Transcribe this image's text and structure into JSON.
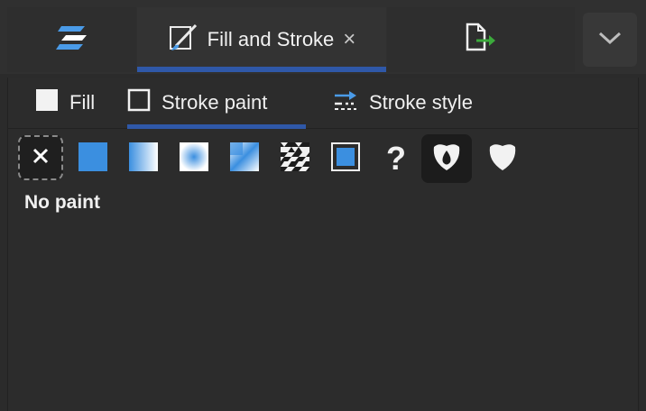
{
  "dock": {
    "active_tab_title": "Fill and Stroke",
    "close_glyph": "×",
    "tabs": [
      {
        "icon": "align-distribute-icon"
      },
      {
        "icon": "fill-and-stroke-icon",
        "title": "Fill and Stroke"
      },
      {
        "icon": "export-icon"
      }
    ],
    "menu_icon": "chevron-down-icon"
  },
  "subtabs": [
    {
      "label": "Fill",
      "icon": "fill-swatch-icon"
    },
    {
      "label": "Stroke paint",
      "icon": "stroke-swatch-icon",
      "active": true
    },
    {
      "label": "Stroke style",
      "icon": "stroke-style-icon"
    }
  ],
  "paint_modes": [
    {
      "name": "no-paint",
      "selected": true
    },
    {
      "name": "flat-color"
    },
    {
      "name": "linear-gradient"
    },
    {
      "name": "radial-gradient"
    },
    {
      "name": "mesh-gradient"
    },
    {
      "name": "pattern"
    },
    {
      "name": "swatch"
    },
    {
      "name": "unset",
      "glyph": "?"
    },
    {
      "name": "fill-rule-evenodd",
      "active": true
    },
    {
      "name": "fill-rule-nonzero"
    }
  ],
  "status_text": "No paint",
  "colors": {
    "accent": "#2f58a8",
    "paint_blue": "#3b8fe0",
    "export_green": "#3caa3c"
  }
}
